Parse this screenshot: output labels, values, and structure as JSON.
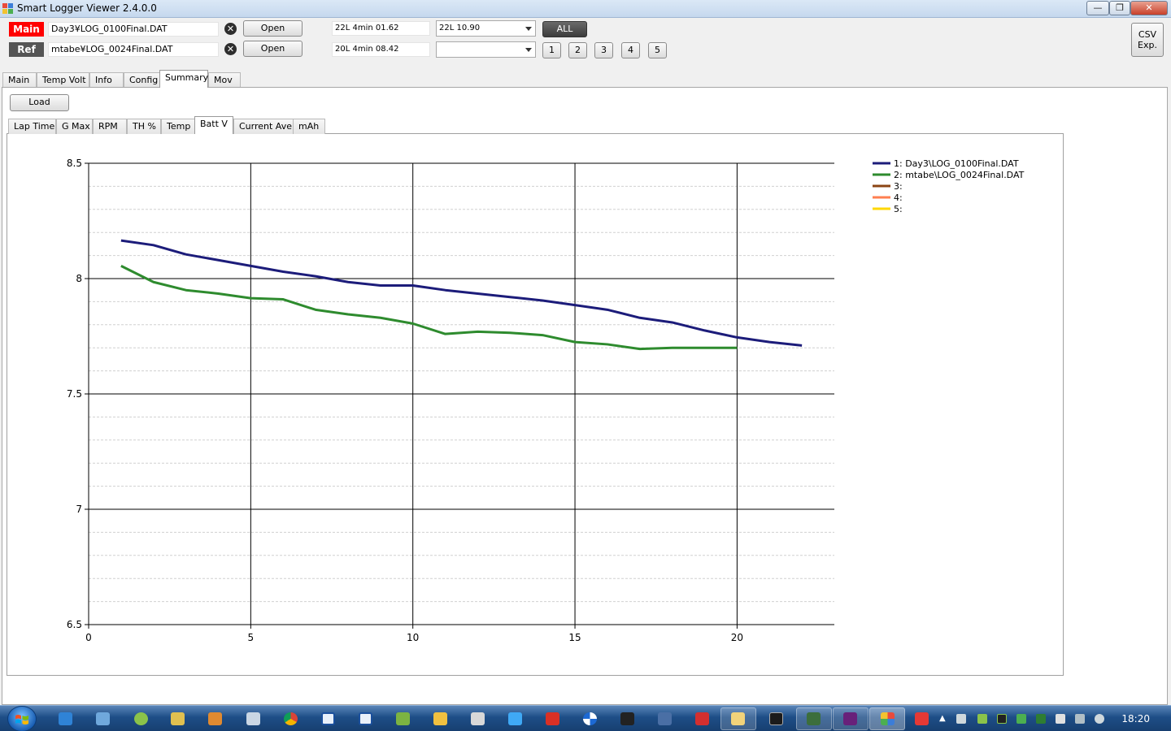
{
  "window": {
    "title": "Smart Logger Viewer 2.4.0.0",
    "min_label": "—",
    "max_label": "❐",
    "close_label": "✕"
  },
  "main_file": {
    "tag": "Main",
    "tag_color": "#ff0000",
    "path": "Day3¥LOG_0100Final.DAT",
    "open_label": "Open",
    "summary": "22L  4min  01.62",
    "lap_select": "22L  10.90"
  },
  "ref_file": {
    "tag": "Ref",
    "tag_color": "#555555",
    "path": "mtabe¥LOG_0024Final.DAT",
    "open_label": "Open",
    "summary": "20L  4min  08.42",
    "lap_select": ""
  },
  "all_label": "ALL",
  "slot_buttons": [
    "1",
    "2",
    "3",
    "4",
    "5"
  ],
  "csv_export": {
    "line1": "CSV",
    "line2": "Exp."
  },
  "main_tabs": [
    "Main",
    "Temp Volt",
    "Info",
    "Config",
    "Summary",
    "Mov"
  ],
  "active_main_tab": "Summary",
  "load_label": "Load",
  "sub_tabs": [
    "Lap Time",
    "G Max",
    "RPM",
    "TH %",
    "Temp",
    "Batt V",
    "Current Ave",
    "mAh"
  ],
  "active_sub_tab": "Batt V",
  "chart_data": {
    "type": "line",
    "title": "",
    "xlabel": "",
    "ylabel": "",
    "xlim": [
      0,
      23
    ],
    "ylim": [
      6.5,
      8.5
    ],
    "x_ticks": [
      "0",
      "5",
      "10",
      "15",
      "20"
    ],
    "y_ticks": [
      "6.5",
      "7",
      "7.5",
      "8",
      "8.5"
    ],
    "x_tick_values": [
      0,
      5,
      10,
      15,
      20
    ],
    "y_tick_values": [
      6.5,
      7,
      7.5,
      8,
      8.5
    ],
    "grid": true,
    "legend_position": "top-right",
    "series": [
      {
        "name": "1: Day3\\LOG_0100Final.DAT",
        "color": "#1c1c7a",
        "x": [
          1,
          2,
          3,
          4,
          5,
          6,
          7,
          8,
          9,
          10,
          11,
          12,
          13,
          14,
          15,
          16,
          17,
          18,
          19,
          20,
          21,
          22
        ],
        "values": [
          8.165,
          8.145,
          8.105,
          8.08,
          8.055,
          8.03,
          8.01,
          7.985,
          7.97,
          7.97,
          7.95,
          7.935,
          7.92,
          7.905,
          7.885,
          7.865,
          7.83,
          7.81,
          7.775,
          7.745,
          7.725,
          7.71
        ]
      },
      {
        "name": "2: mtabe\\LOG_0024Final.DAT",
        "color": "#2e8b2e",
        "x": [
          1,
          2,
          3,
          4,
          5,
          6,
          7,
          8,
          9,
          10,
          11,
          12,
          13,
          14,
          15,
          16,
          17,
          18,
          19,
          20
        ],
        "values": [
          8.055,
          7.985,
          7.95,
          7.935,
          7.915,
          7.91,
          7.865,
          7.845,
          7.83,
          7.805,
          7.76,
          7.77,
          7.765,
          7.755,
          7.725,
          7.715,
          7.695,
          7.7,
          7.7,
          7.7
        ]
      },
      {
        "name": "3:",
        "color": "#8b4513",
        "x": [],
        "values": []
      },
      {
        "name": "4:",
        "color": "#ff7f50",
        "x": [],
        "values": []
      },
      {
        "name": "5:",
        "color": "#ffd700",
        "x": [],
        "values": []
      }
    ]
  },
  "taskbar": {
    "clock": "18:20"
  }
}
